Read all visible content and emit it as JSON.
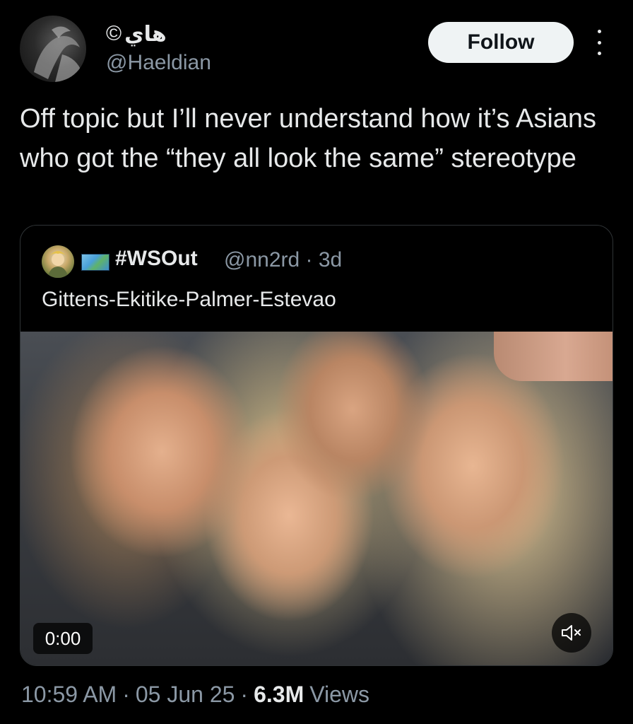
{
  "author": {
    "display_name": "هاي",
    "copyright_symbol": "©",
    "handle": "@Haeldian"
  },
  "actions": {
    "follow_label": "Follow",
    "more_icon": "more-vertical-icon"
  },
  "tweet": {
    "text": "Off topic but I’ll never understand how it’s Asians who got the “they all look the same” stereotype"
  },
  "quoted_tweet": {
    "display_name": "#WSOut",
    "flag_icon": "world-map-emoji",
    "handle": "@nn2rd",
    "separator": "·",
    "age": "3d",
    "text": "Gittens-Ekitike-Palmer-Estevao",
    "media": {
      "type": "video",
      "time": "0:00",
      "mute_icon": "speaker-muted-icon"
    }
  },
  "meta": {
    "time": "10:59 AM",
    "date": "05 Jun 25",
    "views_count": "6.3M",
    "views_label": "Views",
    "separator": "·"
  }
}
